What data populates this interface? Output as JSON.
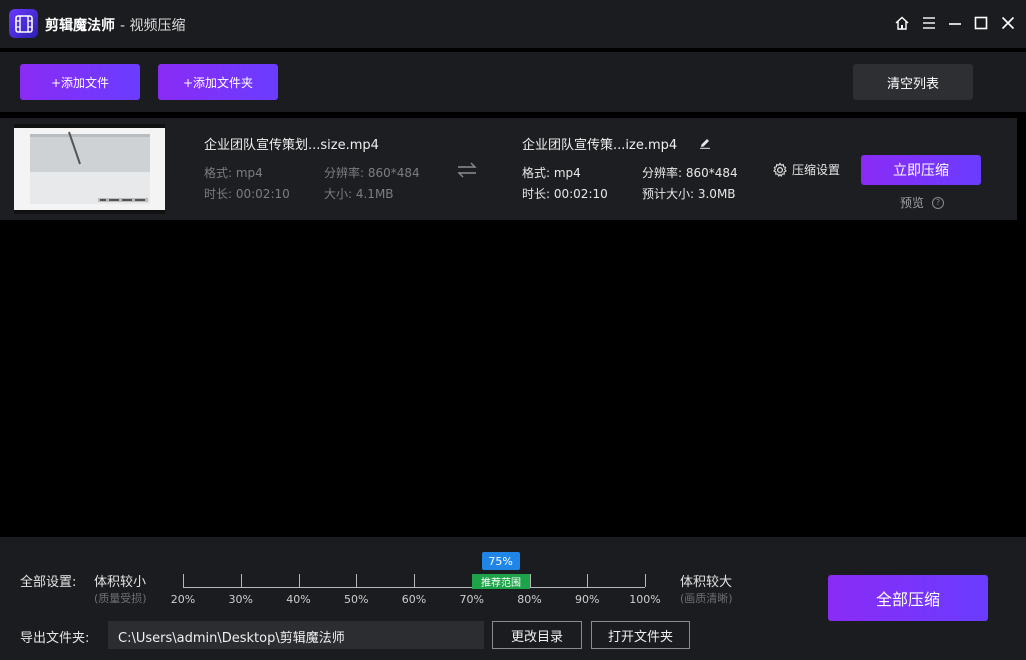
{
  "titlebar": {
    "app_name": "剪辑魔法师",
    "page_title": "- 视频压缩"
  },
  "toolbar": {
    "add_file": "+添加文件",
    "add_folder": "+添加文件夹",
    "clear_list": "清空列表"
  },
  "file": {
    "source": {
      "name": "企业团队宣传策划...size.mp4",
      "format": "格式: mp4",
      "resolution": "分辨率: 860*484",
      "duration": "时长: 00:02:10",
      "size": "大小: 4.1MB"
    },
    "output": {
      "name": "企业团队宣传策...ize.mp4",
      "format": "格式: mp4",
      "resolution": "分辨率: 860*484",
      "duration": "时长: 00:02:10",
      "est_size": "预计大小: 3.0MB"
    },
    "settings_label": "压缩设置",
    "compress_now": "立即压缩",
    "preview_label": "预览",
    "preview_help": "?"
  },
  "bottom": {
    "global_settings": "全部设置:",
    "smaller_label": "体积较小",
    "smaller_sub": "(质量受损)",
    "larger_label": "体积较大",
    "larger_sub": "(画质清晰)",
    "slider_value": 75,
    "slider_badge": "75%",
    "recommended": "推荐范围",
    "ticks": [
      "20%",
      "30%",
      "40%",
      "50%",
      "60%",
      "70%",
      "80%",
      "90%",
      "100%"
    ],
    "output_folder_label": "导出文件夹:",
    "output_path": "C:\\Users\\admin\\Desktop\\剪辑魔法师",
    "change_dir": "更改目录",
    "open_folder": "打开文件夹",
    "compress_all": "全部压缩"
  },
  "colors": {
    "accent_purple": "#8a2bf5",
    "accent_violet": "#6a3cff",
    "badge_blue": "#1f86e8",
    "recommended_green": "#1fa34a"
  }
}
